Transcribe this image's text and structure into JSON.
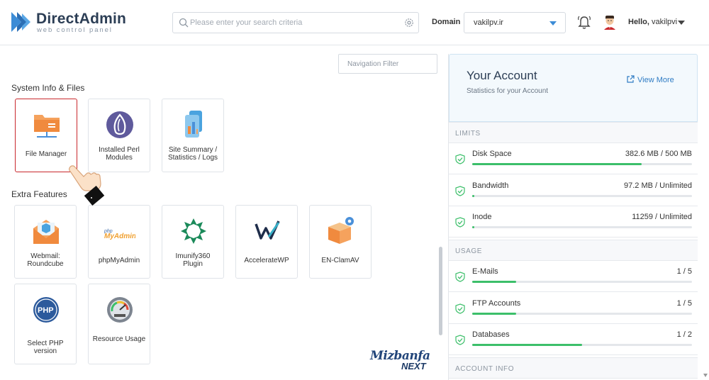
{
  "brand": {
    "title": "DirectAdmin",
    "subtitle": "web control panel"
  },
  "search": {
    "placeholder": "Please enter your search criteria"
  },
  "domain": {
    "label": "Domain",
    "value": "vakilpv.ir"
  },
  "user": {
    "greeting": "Hello,",
    "name": "vakilpvi"
  },
  "navigation_filter": {
    "placeholder": "Navigation Filter"
  },
  "sections": [
    {
      "title": "System Info & Files",
      "tiles": [
        {
          "label": "File Manager",
          "icon": "folder-icon"
        },
        {
          "label": "Installed Perl Modules",
          "icon": "perl-onion-icon"
        },
        {
          "label": "Site Summary / Statistics / Logs",
          "icon": "statistics-icon"
        }
      ]
    },
    {
      "title": "Extra Features",
      "tiles": [
        {
          "label": "Webmail: Roundcube",
          "icon": "webmail-icon"
        },
        {
          "label": "phpMyAdmin",
          "icon": "phpmyadmin-icon",
          "logo_text": "php MyAdmin"
        },
        {
          "label": "Imunify360 Plugin",
          "icon": "imunify-icon"
        },
        {
          "label": "AccelerateWP",
          "icon": "acceleratewp-icon"
        },
        {
          "label": "EN-ClamAV",
          "icon": "clamav-box-icon"
        },
        {
          "label": "Select PHP version",
          "icon": "php-icon",
          "logo_text": "PHP"
        },
        {
          "label": "Resource Usage",
          "icon": "gauge-icon"
        }
      ]
    }
  ],
  "watermark": {
    "line1": "Mizbanfa",
    "line2": "NEXT"
  },
  "account": {
    "title": "Your Account",
    "subtitle": "Statistics for your Account",
    "view_more": "View More",
    "categories": {
      "limits": "LIMITS",
      "usage": "USAGE",
      "account_info": "ACCOUNT INFO"
    },
    "limits": [
      {
        "name": "Disk Space",
        "value": "382.6 MB / 500 MB",
        "fraction": 0.77
      },
      {
        "name": "Bandwidth",
        "value": "97.2 MB / Unlimited",
        "fraction": 0.0
      },
      {
        "name": "Inode",
        "value": "11259 / Unlimited",
        "fraction": 0.0
      }
    ],
    "usage": [
      {
        "name": "E-Mails",
        "value": "1 / 5",
        "fraction": 0.2
      },
      {
        "name": "FTP Accounts",
        "value": "1 / 5",
        "fraction": 0.2
      },
      {
        "name": "Databases",
        "value": "1 / 2",
        "fraction": 0.5
      }
    ]
  },
  "colors": {
    "brand_blue": "#2f7cc4",
    "progress_green": "#3cbf6a",
    "active_border": "#c9282d",
    "brand_text": "#2c3e55"
  }
}
